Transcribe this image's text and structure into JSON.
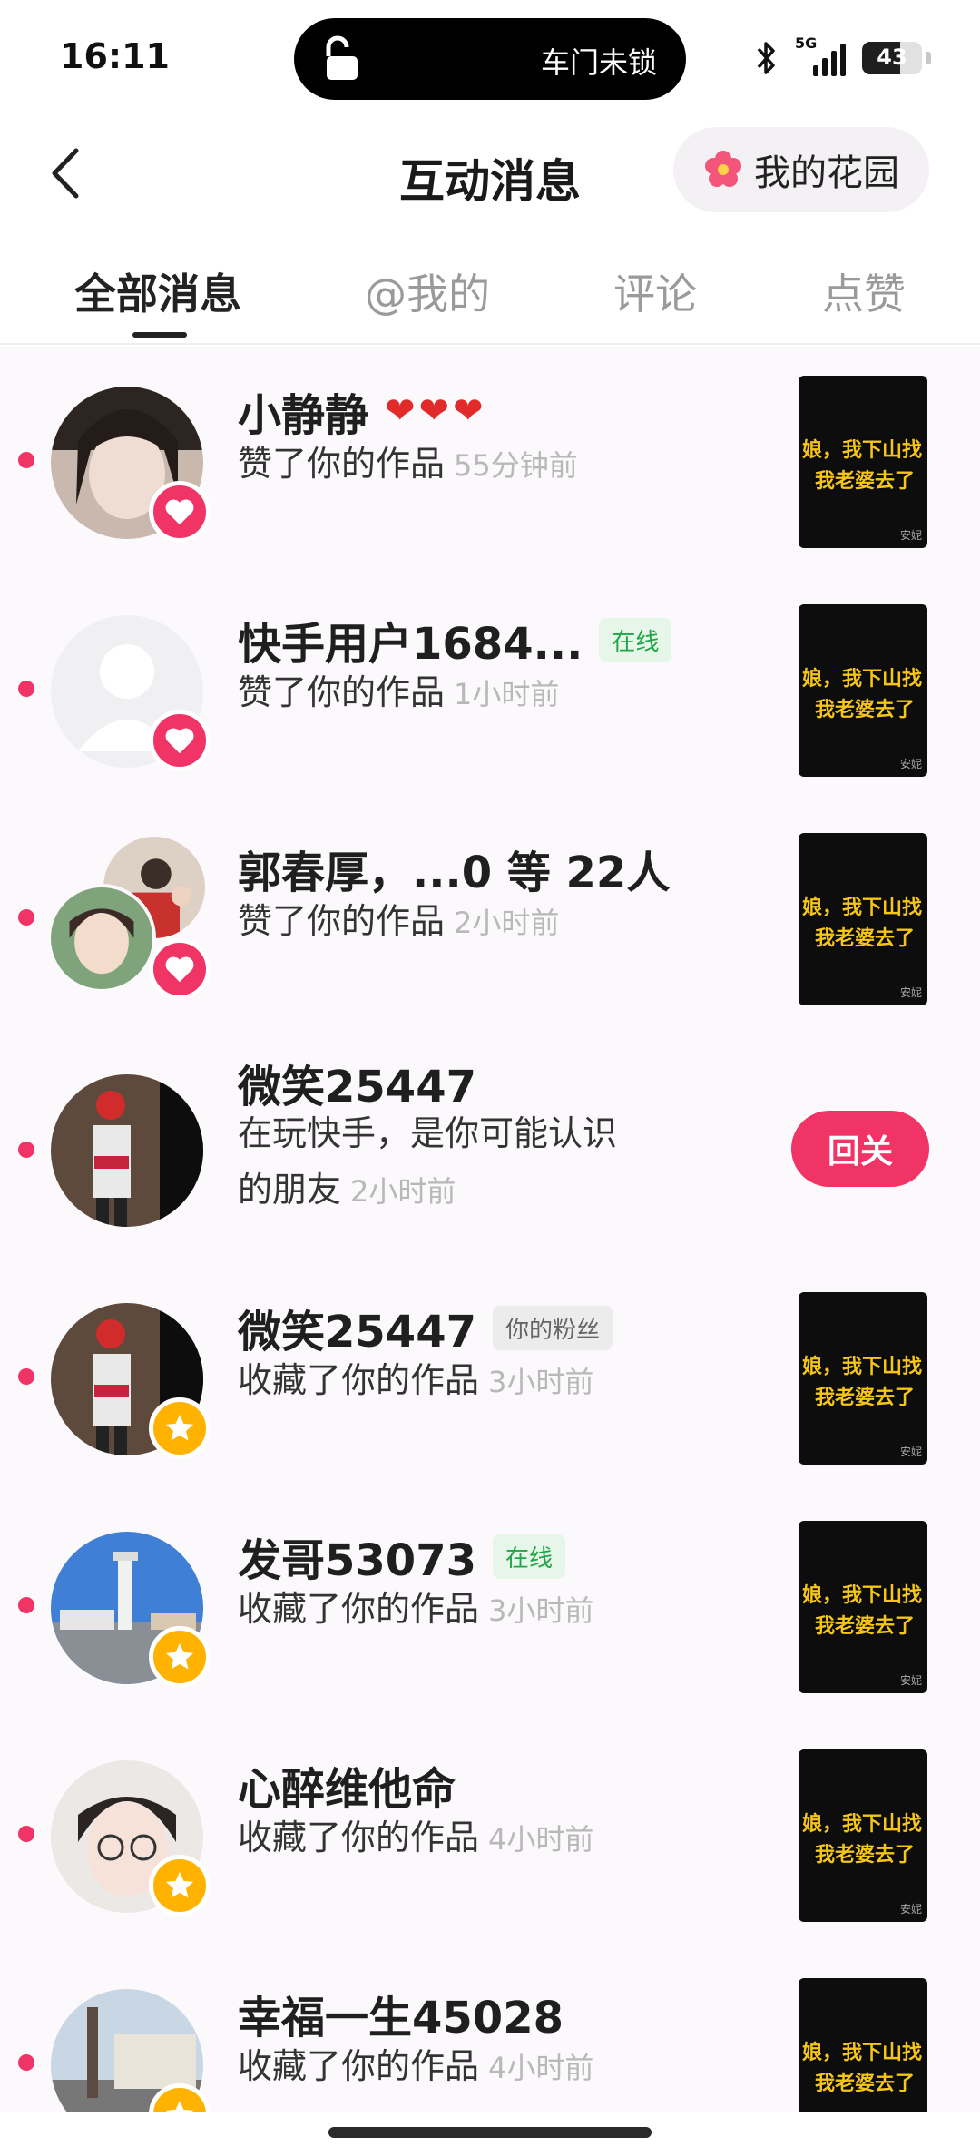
{
  "status_bar": {
    "time": "16:11",
    "island_text": "车门未锁",
    "network": "5G",
    "battery": "43"
  },
  "header": {
    "title": "互动消息",
    "garden_button": "我的花园"
  },
  "tabs": [
    {
      "label": "全部消息",
      "active": true
    },
    {
      "label": "@我的",
      "active": false
    },
    {
      "label": "评论",
      "active": false
    },
    {
      "label": "点赞",
      "active": false
    }
  ],
  "thumbnail": {
    "caption_line1": "娘，我下山找",
    "caption_line2": "我老婆去了",
    "watermark": "安妮"
  },
  "messages": [
    {
      "name": "小静静",
      "hearts": "❤❤❤",
      "tag": "",
      "action": "赞了你的作品",
      "time": "55分钟前",
      "badge": "heart"
    },
    {
      "name": "快手用户1684...",
      "hearts": "",
      "tag": "在线",
      "action": "赞了你的作品",
      "time": "1小时前",
      "badge": "heart"
    },
    {
      "name": "郭春厚，...0 等 22人",
      "hearts": "",
      "tag": "",
      "action": "赞了你的作品",
      "time": "2小时前",
      "badge": "heart"
    },
    {
      "name": "微笑25447",
      "hearts": "",
      "tag": "",
      "action": "在玩快手，是你可能认识的朋友",
      "time": "2小时前",
      "badge": "",
      "follow_button": "回关"
    },
    {
      "name": "微笑25447",
      "hearts": "",
      "tag": "你的粉丝",
      "action": "收藏了你的作品",
      "time": "3小时前",
      "badge": "star"
    },
    {
      "name": "发哥53073",
      "hearts": "",
      "tag": "在线",
      "action": "收藏了你的作品",
      "time": "3小时前",
      "badge": "star"
    },
    {
      "name": "心醉维他命",
      "hearts": "",
      "tag": "",
      "action": "收藏了你的作品",
      "time": "4小时前",
      "badge": "star"
    },
    {
      "name": "幸福一生45028",
      "hearts": "",
      "tag": "",
      "action": "收藏了你的作品",
      "time": "4小时前",
      "badge": "star"
    }
  ],
  "colors": {
    "accent": "#f03466",
    "star": "#ffb300",
    "online_tag": "#21a547",
    "time_gray": "#b8b8b8"
  }
}
